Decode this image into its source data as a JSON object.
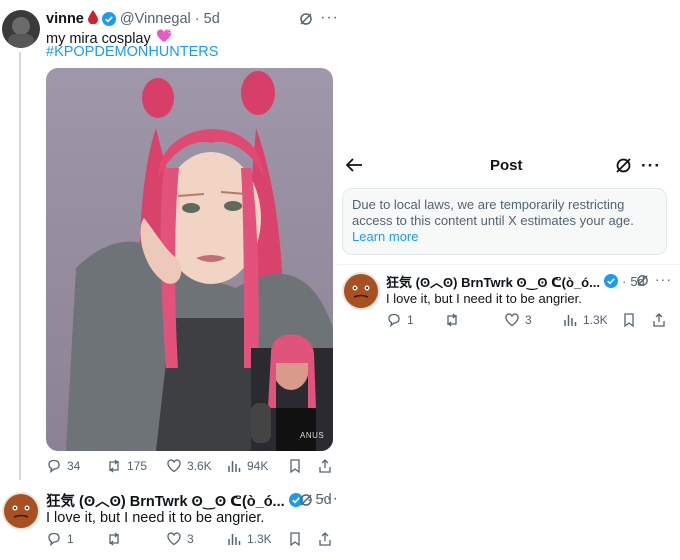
{
  "tweet": {
    "display_name": "vinne",
    "handle": "@Vinnegal",
    "time": "5d",
    "text": "my mira cosplay",
    "hashtag": "#KPOPDEMONHUNTERS",
    "actions": {
      "replies": "34",
      "reposts": "175",
      "likes": "3.6K",
      "views": "94K"
    },
    "image_print": "ANUS"
  },
  "reply": {
    "display_name": "狂気 (ʘ︿ʘ) BrnTwrk ʘ‿ʘ ᕦ(ò_ó...",
    "time": "5d",
    "text": "I love it, but I need it to be angrier.",
    "actions": {
      "replies": "1",
      "reposts": "",
      "likes": "3",
      "views": "1.3K"
    }
  },
  "post_view": {
    "title": "Post",
    "notice_text": "Due to local laws, we are temporarily restricting access to this content until X estimates your age.",
    "notice_link": "Learn more",
    "reply": {
      "display_name": "狂気 (ʘ︿ʘ) BrnTwrk ʘ‿ʘ ᕦ(ò_ó...",
      "time": "5d",
      "text": "I love it, but I need it to be angrier.",
      "actions": {
        "replies": "1",
        "likes": "3",
        "views": "1.3K"
      }
    }
  },
  "icons": [
    "blood-drop-icon",
    "heart-emoji-icon",
    "verified-badge-icon",
    "grok-icon",
    "more-icon",
    "reply-icon",
    "repost-icon",
    "like-icon",
    "views-icon",
    "bookmark-icon",
    "share-icon",
    "back-arrow-icon"
  ],
  "colors": {
    "link": "#1d9bf0",
    "secondary_text": "#536471",
    "verified": "#1d9bf0",
    "notice_bg": "#f7f9f9",
    "divider": "#cfd9de"
  }
}
